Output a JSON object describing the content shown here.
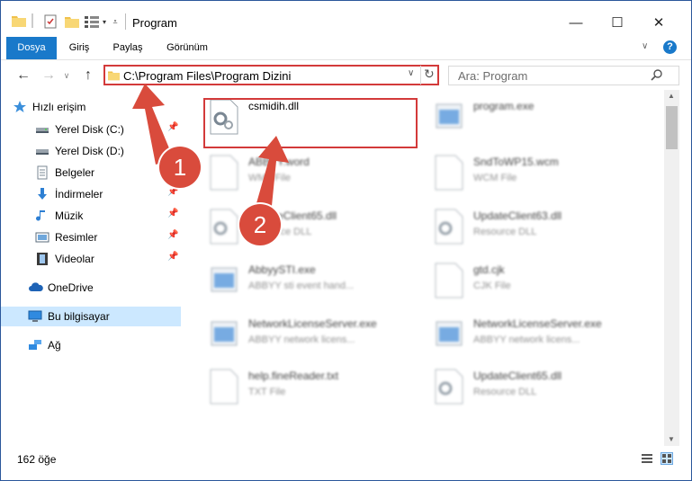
{
  "window": {
    "title": "Program"
  },
  "window_controls": {
    "minimize": "—",
    "maximize": "☐",
    "close": "✕"
  },
  "ribbon": {
    "tabs": [
      "Dosya",
      "Giriş",
      "Paylaş",
      "Görünüm"
    ],
    "help": "?"
  },
  "address": {
    "path": "C:\\Program Files\\Program Dizini"
  },
  "search": {
    "placeholder": "Ara: Program"
  },
  "sidebar": {
    "items": [
      {
        "label": "Hızlı erişim",
        "icon": "star-icon"
      },
      {
        "label": "Yerel Disk (C:)",
        "icon": "drive-icon",
        "pinned": true
      },
      {
        "label": "Yerel Disk (D:)",
        "icon": "drive-icon"
      },
      {
        "label": "Belgeler",
        "icon": "documents-icon"
      },
      {
        "label": "İndirmeler",
        "icon": "download-icon",
        "pinned": true
      },
      {
        "label": "Müzik",
        "icon": "music-icon",
        "pinned": true
      },
      {
        "label": "Resimler",
        "icon": "pictures-icon",
        "pinned": true
      },
      {
        "label": "Videolar",
        "icon": "video-icon",
        "pinned": true
      },
      {
        "label": "OneDrive",
        "icon": "cloud-icon"
      },
      {
        "label": "Bu bilgisayar",
        "icon": "computer-icon",
        "selected": true
      },
      {
        "label": "Ağ",
        "icon": "network-icon"
      }
    ]
  },
  "files": [
    {
      "name": "csmidih.dll",
      "type": "",
      "icon": "dll-gear-icon"
    },
    {
      "name": "program.exe",
      "type": "",
      "icon": "exe-icon"
    },
    {
      "name": "ABBYY.word",
      "type": "WMF File",
      "icon": "file-icon"
    },
    {
      "name": "SndToWP15.wcm",
      "type": "WCM File",
      "icon": "file-icon"
    },
    {
      "name": "UpdateClient65.dll",
      "type": "Resource DLL",
      "icon": "dll-gear-icon"
    },
    {
      "name": "UpdateClient63.dll",
      "type": "Resource DLL",
      "icon": "dll-gear-icon"
    },
    {
      "name": "AbbyySTI.exe",
      "type": "ABBYY sti event hand...",
      "icon": "exe-icon"
    },
    {
      "name": "gtd.cjk",
      "type": "CJK File",
      "icon": "file-icon"
    },
    {
      "name": "NetworkLicenseServer.exe",
      "type": "ABBYY network licens...",
      "icon": "exe-icon"
    },
    {
      "name": "NetworkLicenseServer.exe",
      "type": "ABBYY network licens...",
      "icon": "exe-icon"
    },
    {
      "name": "help.fineReader.txt",
      "type": "TXT File",
      "icon": "file-icon"
    },
    {
      "name": "UpdateClient65.dll",
      "type": "Resource DLL",
      "icon": "dll-gear-icon"
    }
  ],
  "status": {
    "count": "162 öğe"
  },
  "annotations": [
    {
      "label": "1"
    },
    {
      "label": "2"
    }
  ],
  "colors": {
    "accent": "#1979ca",
    "highlight": "#d33a3a",
    "badge": "#d94b3c"
  }
}
